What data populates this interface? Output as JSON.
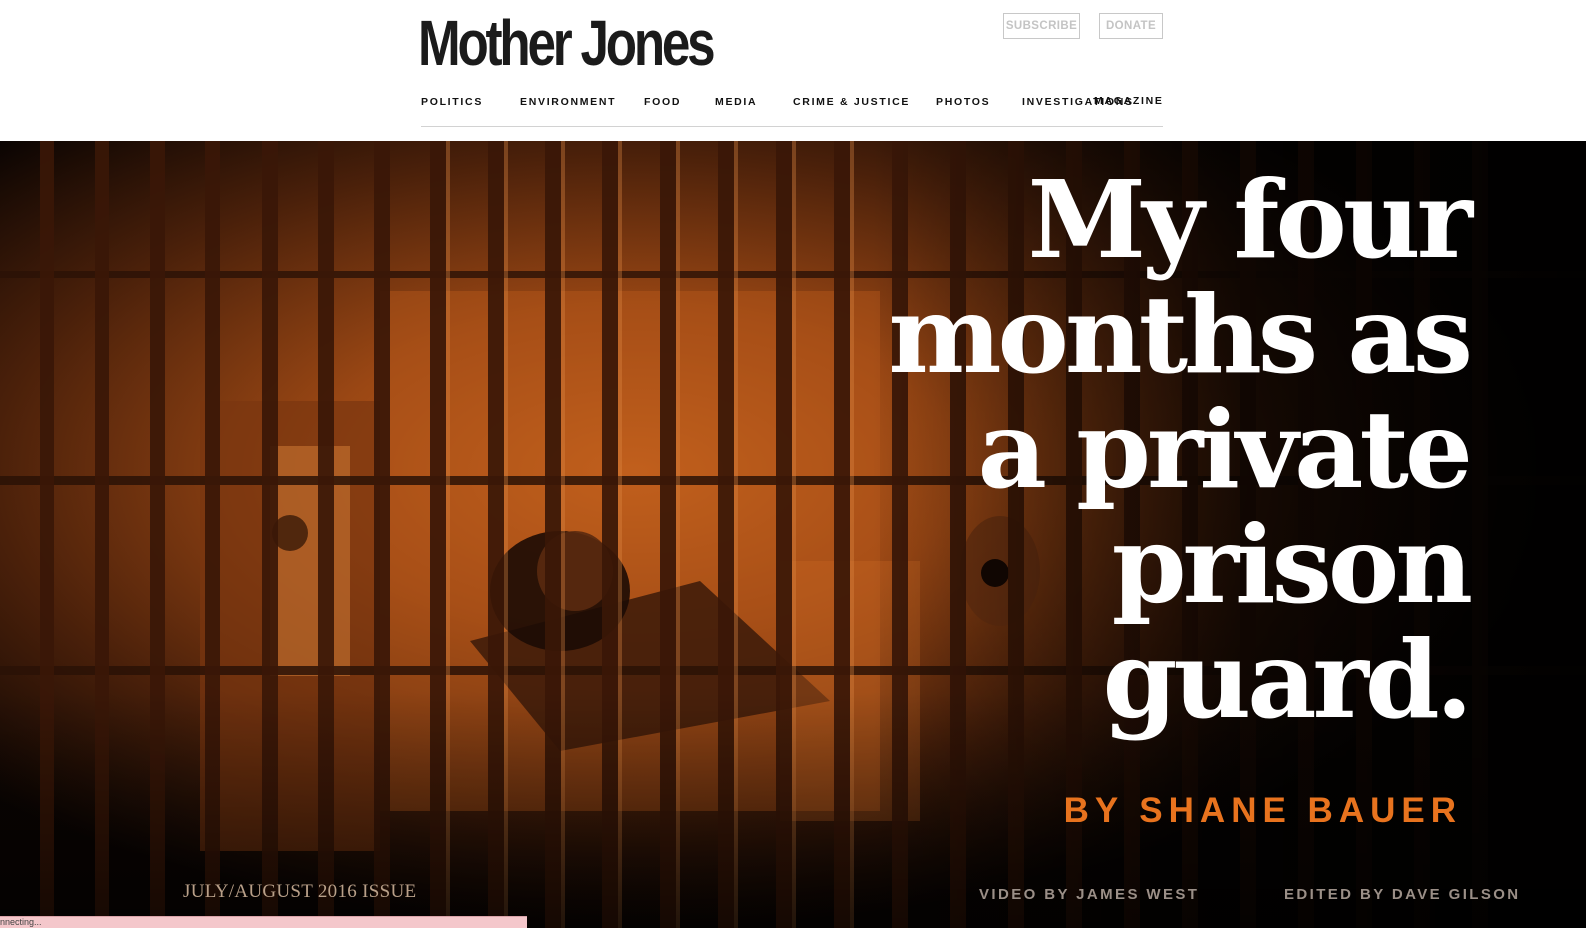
{
  "header": {
    "logo": "Mother Jones",
    "subscribe_label": "SUBSCRIBE",
    "donate_label": "DONATE",
    "nav": [
      "POLITICS",
      "ENVIRONMENT",
      "FOOD",
      "MEDIA",
      "CRIME & JUSTICE",
      "PHOTOS",
      "INVESTIGATIONS",
      "MAGAZINE"
    ]
  },
  "hero": {
    "headline_lines": [
      "My four",
      "months as",
      "a private",
      "prison",
      "guard."
    ],
    "byline": "BY SHANE BAUER",
    "issue": "JULY/AUGUST 2016 ISSUE",
    "video_credit": "VIDEO BY JAMES WEST",
    "edit_credit": "EDITED BY DAVE GILSON"
  },
  "status_bar": {
    "text": "nnecting..."
  },
  "colors": {
    "accent_orange": "#e8731e",
    "photo_tint": "#b8581c",
    "logo_text": "#1b1b1b"
  }
}
